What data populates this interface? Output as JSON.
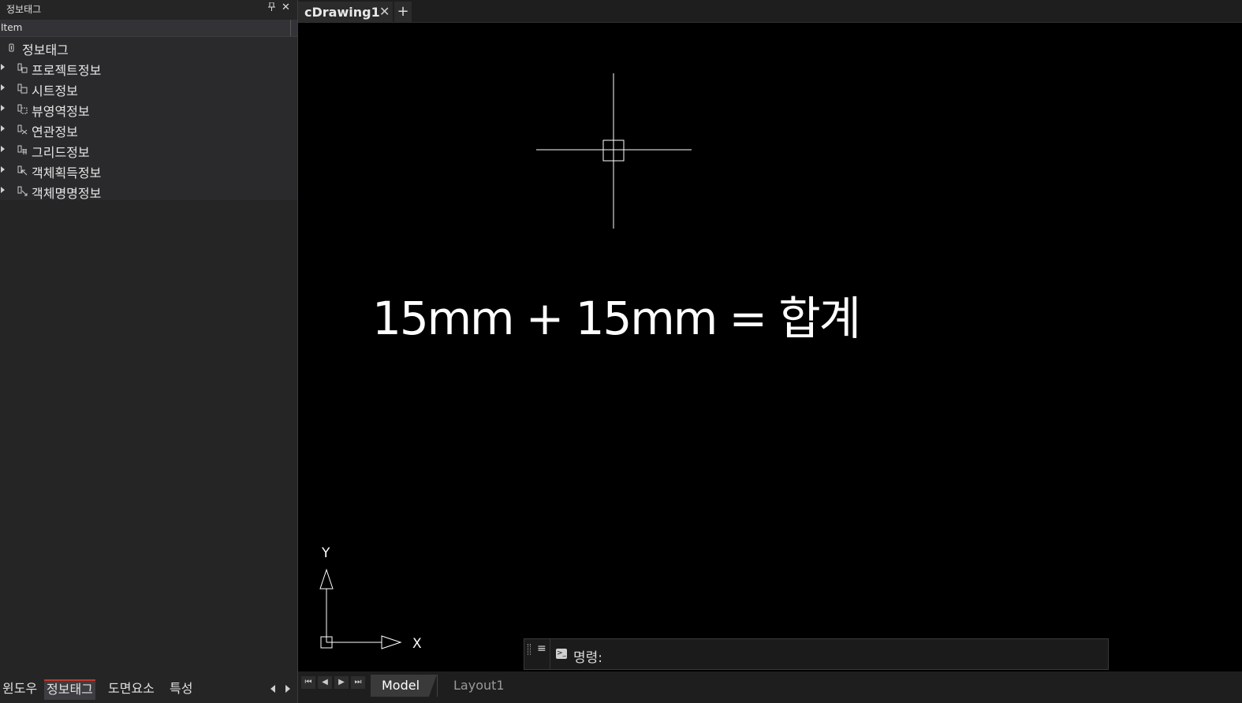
{
  "panel": {
    "title": "정보태그",
    "column_header": "Item",
    "root": "정보태그",
    "items": [
      {
        "label": "프로젝트정보"
      },
      {
        "label": "시트정보"
      },
      {
        "label": "뷰영역정보"
      },
      {
        "label": "연관정보"
      },
      {
        "label": "그리드정보"
      },
      {
        "label": "객체획득정보"
      },
      {
        "label": "객체명명정보"
      }
    ],
    "bottom_tabs": [
      {
        "label": "윈도우",
        "active": false
      },
      {
        "label": "정보태그",
        "active": true
      },
      {
        "label": "도면요소",
        "active": false
      },
      {
        "label": "특성",
        "active": false
      }
    ]
  },
  "document": {
    "tab_label": "cDrawing1",
    "close_glyph": "✕",
    "new_tab_glyph": "+"
  },
  "drawing": {
    "text": "15mm + 15mm = 합계",
    "ucs_x": "X",
    "ucs_y": "Y"
  },
  "command": {
    "label": "명령:",
    "menu_glyph": "≡",
    "value": ""
  },
  "layouts": {
    "nav": [
      "⏮",
      "◀",
      "▶",
      "⏭"
    ],
    "tabs": [
      {
        "label": "Model",
        "active": true
      },
      {
        "label": "Layout1",
        "active": false
      }
    ]
  },
  "colors": {
    "canvas_bg": "#000000",
    "panel_bg": "#252526",
    "active_tab_accent": "#c0392b"
  }
}
